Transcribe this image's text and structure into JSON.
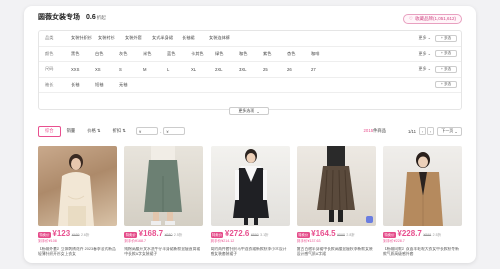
{
  "header": {
    "title": "圆薇女装专场",
    "count": "0.6",
    "count_unit": "折起",
    "fav_label": "收藏品牌(1,051,612)"
  },
  "filters": [
    {
      "label": "品类",
      "options": [
        "女装针织衫",
        "女装衬衫",
        "女装外套",
        "女式半身裙",
        "长袖裙",
        "女装连体裤"
      ],
      "more": "更多",
      "multi": "+ 多选"
    },
    {
      "label": "颜色",
      "options": [
        "黑色",
        "白色",
        "灰色",
        "米色",
        "蓝色",
        "卡其色",
        "绿色",
        "咖色",
        "紫色",
        "杏色",
        "咖啡"
      ],
      "more": "更多",
      "multi": "+ 多选"
    },
    {
      "label": "尺码",
      "options": [
        "XXS",
        "XS",
        "S",
        "M",
        "L",
        "XL",
        "2XL",
        "3XL",
        "25",
        "26",
        "27"
      ],
      "more": "更多",
      "multi": "+ 多选"
    },
    {
      "label": "袖长",
      "options": [
        "长袖",
        "短袖",
        "无袖"
      ],
      "more": "",
      "multi": "+ 多选"
    }
  ],
  "more_options": "更多选项",
  "sort": {
    "items": [
      "综合",
      "销量",
      "价格",
      "折扣"
    ],
    "price_from": "¥",
    "price_to": "¥",
    "result_count": "2015",
    "result_suffix": "件商品",
    "page": "1/11",
    "next": "下一页"
  },
  "products": [
    {
      "tag": "特卖价",
      "price": "¥123",
      "orig": "¥469",
      "discount": "2.6折",
      "sub": "到手价¥108",
      "desc": "【杨幂外套】立体刺绣花卉 2023春季法式新品轻薄针织开衫女上衣女"
    },
    {
      "tag": "特卖价",
      "price": "¥168.7",
      "orig": "¥680",
      "discount": "2.5折",
      "sub": "到手价¥168.7",
      "desc": "纯棉高腰开叉水洗牛仔半身裙新款显瘦直筒裙中长款A字女装裙子"
    },
    {
      "tag": "特卖价",
      "price": "¥272.6",
      "orig": "¥890",
      "discount": "3.1折",
      "sub": "到手价¥214.12",
      "desc": "简约两件套针织马甲连衣裙新款秋季小众设计感女装套装裙子"
    },
    {
      "tag": "特卖价",
      "price": "¥164.5",
      "orig": "¥598",
      "discount": "2.8折",
      "sub": "到手价¥137.63",
      "desc": "复古百褶半身裙中长款高腰显瘦秋季新款女装设计感气质A字裙"
    },
    {
      "tag": "特卖价",
      "price": "¥228.7",
      "orig": "¥899",
      "discount": "2.5折",
      "sub": "到手价¥228.7",
      "desc": "【杨幂同款】双面羊毛呢大衣女中长款秋冬新款气质高级感外套"
    }
  ]
}
